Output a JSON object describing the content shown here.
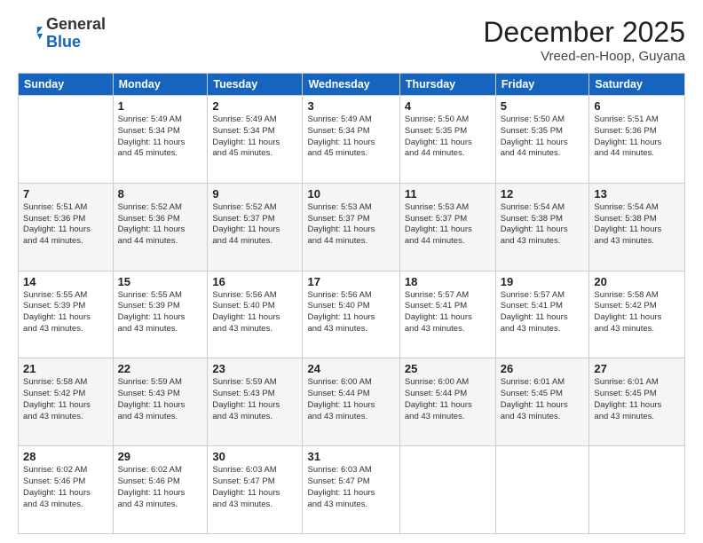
{
  "header": {
    "logo_general": "General",
    "logo_blue": "Blue",
    "month": "December 2025",
    "location": "Vreed-en-Hoop, Guyana"
  },
  "weekdays": [
    "Sunday",
    "Monday",
    "Tuesday",
    "Wednesday",
    "Thursday",
    "Friday",
    "Saturday"
  ],
  "weeks": [
    [
      {
        "day": "",
        "detail": ""
      },
      {
        "day": "1",
        "detail": "Sunrise: 5:49 AM\nSunset: 5:34 PM\nDaylight: 11 hours\nand 45 minutes."
      },
      {
        "day": "2",
        "detail": "Sunrise: 5:49 AM\nSunset: 5:34 PM\nDaylight: 11 hours\nand 45 minutes."
      },
      {
        "day": "3",
        "detail": "Sunrise: 5:49 AM\nSunset: 5:34 PM\nDaylight: 11 hours\nand 45 minutes."
      },
      {
        "day": "4",
        "detail": "Sunrise: 5:50 AM\nSunset: 5:35 PM\nDaylight: 11 hours\nand 44 minutes."
      },
      {
        "day": "5",
        "detail": "Sunrise: 5:50 AM\nSunset: 5:35 PM\nDaylight: 11 hours\nand 44 minutes."
      },
      {
        "day": "6",
        "detail": "Sunrise: 5:51 AM\nSunset: 5:36 PM\nDaylight: 11 hours\nand 44 minutes."
      }
    ],
    [
      {
        "day": "7",
        "detail": "Sunrise: 5:51 AM\nSunset: 5:36 PM\nDaylight: 11 hours\nand 44 minutes."
      },
      {
        "day": "8",
        "detail": "Sunrise: 5:52 AM\nSunset: 5:36 PM\nDaylight: 11 hours\nand 44 minutes."
      },
      {
        "day": "9",
        "detail": "Sunrise: 5:52 AM\nSunset: 5:37 PM\nDaylight: 11 hours\nand 44 minutes."
      },
      {
        "day": "10",
        "detail": "Sunrise: 5:53 AM\nSunset: 5:37 PM\nDaylight: 11 hours\nand 44 minutes."
      },
      {
        "day": "11",
        "detail": "Sunrise: 5:53 AM\nSunset: 5:37 PM\nDaylight: 11 hours\nand 44 minutes."
      },
      {
        "day": "12",
        "detail": "Sunrise: 5:54 AM\nSunset: 5:38 PM\nDaylight: 11 hours\nand 43 minutes."
      },
      {
        "day": "13",
        "detail": "Sunrise: 5:54 AM\nSunset: 5:38 PM\nDaylight: 11 hours\nand 43 minutes."
      }
    ],
    [
      {
        "day": "14",
        "detail": "Sunrise: 5:55 AM\nSunset: 5:39 PM\nDaylight: 11 hours\nand 43 minutes."
      },
      {
        "day": "15",
        "detail": "Sunrise: 5:55 AM\nSunset: 5:39 PM\nDaylight: 11 hours\nand 43 minutes."
      },
      {
        "day": "16",
        "detail": "Sunrise: 5:56 AM\nSunset: 5:40 PM\nDaylight: 11 hours\nand 43 minutes."
      },
      {
        "day": "17",
        "detail": "Sunrise: 5:56 AM\nSunset: 5:40 PM\nDaylight: 11 hours\nand 43 minutes."
      },
      {
        "day": "18",
        "detail": "Sunrise: 5:57 AM\nSunset: 5:41 PM\nDaylight: 11 hours\nand 43 minutes."
      },
      {
        "day": "19",
        "detail": "Sunrise: 5:57 AM\nSunset: 5:41 PM\nDaylight: 11 hours\nand 43 minutes."
      },
      {
        "day": "20",
        "detail": "Sunrise: 5:58 AM\nSunset: 5:42 PM\nDaylight: 11 hours\nand 43 minutes."
      }
    ],
    [
      {
        "day": "21",
        "detail": "Sunrise: 5:58 AM\nSunset: 5:42 PM\nDaylight: 11 hours\nand 43 minutes."
      },
      {
        "day": "22",
        "detail": "Sunrise: 5:59 AM\nSunset: 5:43 PM\nDaylight: 11 hours\nand 43 minutes."
      },
      {
        "day": "23",
        "detail": "Sunrise: 5:59 AM\nSunset: 5:43 PM\nDaylight: 11 hours\nand 43 minutes."
      },
      {
        "day": "24",
        "detail": "Sunrise: 6:00 AM\nSunset: 5:44 PM\nDaylight: 11 hours\nand 43 minutes."
      },
      {
        "day": "25",
        "detail": "Sunrise: 6:00 AM\nSunset: 5:44 PM\nDaylight: 11 hours\nand 43 minutes."
      },
      {
        "day": "26",
        "detail": "Sunrise: 6:01 AM\nSunset: 5:45 PM\nDaylight: 11 hours\nand 43 minutes."
      },
      {
        "day": "27",
        "detail": "Sunrise: 6:01 AM\nSunset: 5:45 PM\nDaylight: 11 hours\nand 43 minutes."
      }
    ],
    [
      {
        "day": "28",
        "detail": "Sunrise: 6:02 AM\nSunset: 5:46 PM\nDaylight: 11 hours\nand 43 minutes."
      },
      {
        "day": "29",
        "detail": "Sunrise: 6:02 AM\nSunset: 5:46 PM\nDaylight: 11 hours\nand 43 minutes."
      },
      {
        "day": "30",
        "detail": "Sunrise: 6:03 AM\nSunset: 5:47 PM\nDaylight: 11 hours\nand 43 minutes."
      },
      {
        "day": "31",
        "detail": "Sunrise: 6:03 AM\nSunset: 5:47 PM\nDaylight: 11 hours\nand 43 minutes."
      },
      {
        "day": "",
        "detail": ""
      },
      {
        "day": "",
        "detail": ""
      },
      {
        "day": "",
        "detail": ""
      }
    ]
  ]
}
